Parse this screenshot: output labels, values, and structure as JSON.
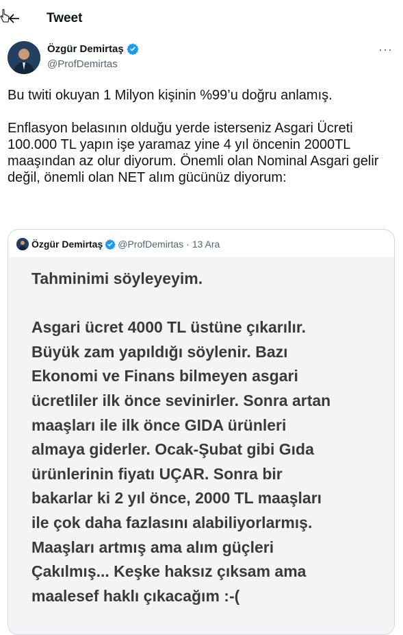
{
  "header": {
    "title": "Tweet",
    "back_icon": "arrow-left-icon"
  },
  "author": {
    "name": "Özgür Demirtaş",
    "handle": "@ProfDemirtas",
    "verified_icon": "verified-badge-icon"
  },
  "more_icon": "more-horizontal-icon",
  "more_label": "···",
  "tweet": {
    "text": "Bu twiti okuyan 1 Milyon kişinin %99’u doğru anlamış.\n\nEnflasyon belasının olduğu yerde isterseniz Asgari Ücreti 100.000 TL yapın işe yaramaz yine 4 yıl öncenin 2000TL maaşından az olur diyorum. Önemli olan Nominal Asgari gelir değil, önemli olan NET alım gücünüz diyorum:"
  },
  "quote": {
    "name": "Özgür Demirtaş",
    "handle": "@ProfDemirtas",
    "separator": "·",
    "date": "13 Ara",
    "image_text": "Tahminimi söyleyeyim.\n\nAsgari ücret 4000 TL üstüne çıkarılır.\nBüyük zam yapıldığı söylenir. Bazı\nEkonomi ve Finans bilmeyen asgari\nücretliler ilk önce sevinirler. Sonra artan\nmaaşları ile ilk önce GIDA ürünleri\nalmaya giderler. Ocak-Şubat gibi Gıda\nürünlerinin fiyatı UÇAR. Sonra bir\nbakarlar ki 2 yıl önce, 2000 TL maaşları\nile çok daha fazlasını alabiliyorlarmış.\nMaaşları artmış ama alım güçleri\nÇakılmış... Keşke haksız çıksam ama\nmaalesef haklı çıkacağım :-("
  },
  "colors": {
    "verified": "#1d9bf0",
    "secondary_text": "#536471",
    "border": "#cfd9de"
  }
}
